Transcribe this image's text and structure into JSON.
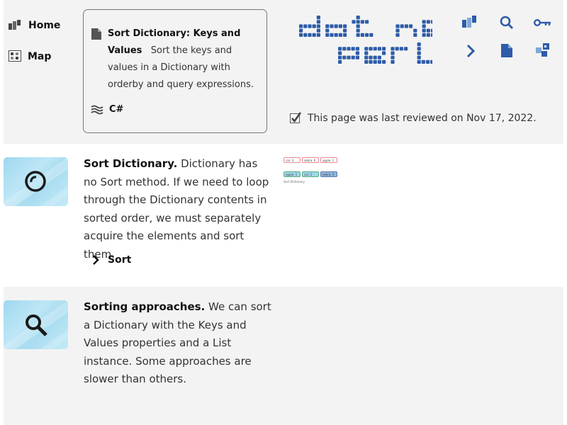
{
  "nav": {
    "items": [
      {
        "label": "Home",
        "icon": "home-icon"
      },
      {
        "label": "Map",
        "icon": "map-icon"
      }
    ]
  },
  "card": {
    "title": "Sort Dictionary: Keys and Values",
    "description": "Sort the keys and values in a Dictionary with orderby and query expressions.",
    "language": "C#"
  },
  "logo": {
    "line1": "dot net",
    "line2": "perls",
    "color": "#2d5ca8"
  },
  "header_icons": [
    "blocks-icon",
    "search-icon",
    "key-icon",
    "chevron-right-icon",
    "document-icon",
    "squares-icon"
  ],
  "reviewed": {
    "text": "This page was last reviewed on Nov 17, 2022.",
    "checked": true
  },
  "sections": [
    {
      "heading": "Sort Dictionary.",
      "body": "Dictionary has no Sort method. If we need to loop through the Dictionary contents in sorted order, we must separately acquire the elements and sort them.",
      "icon": "circle-icon"
    },
    {
      "heading": "Sorting approaches.",
      "body": "We can sort a Dictionary with the Keys and Values properties and a List instance. Some approaches are slower than others.",
      "icon": "magnifier-icon"
    }
  ],
  "sort_link": {
    "label": "Sort"
  },
  "diagram": {
    "row1": [
      "car: 2",
      "zebra: 0",
      "apple: 1"
    ],
    "row2": [
      "apple: 1",
      "car: 2",
      "zebra: 0"
    ],
    "caption": "Sort Dictionary"
  },
  "colors": {
    "band": "#f3f3f3",
    "accent": "#2d5ca8",
    "thumb": "#a8dcf0"
  }
}
